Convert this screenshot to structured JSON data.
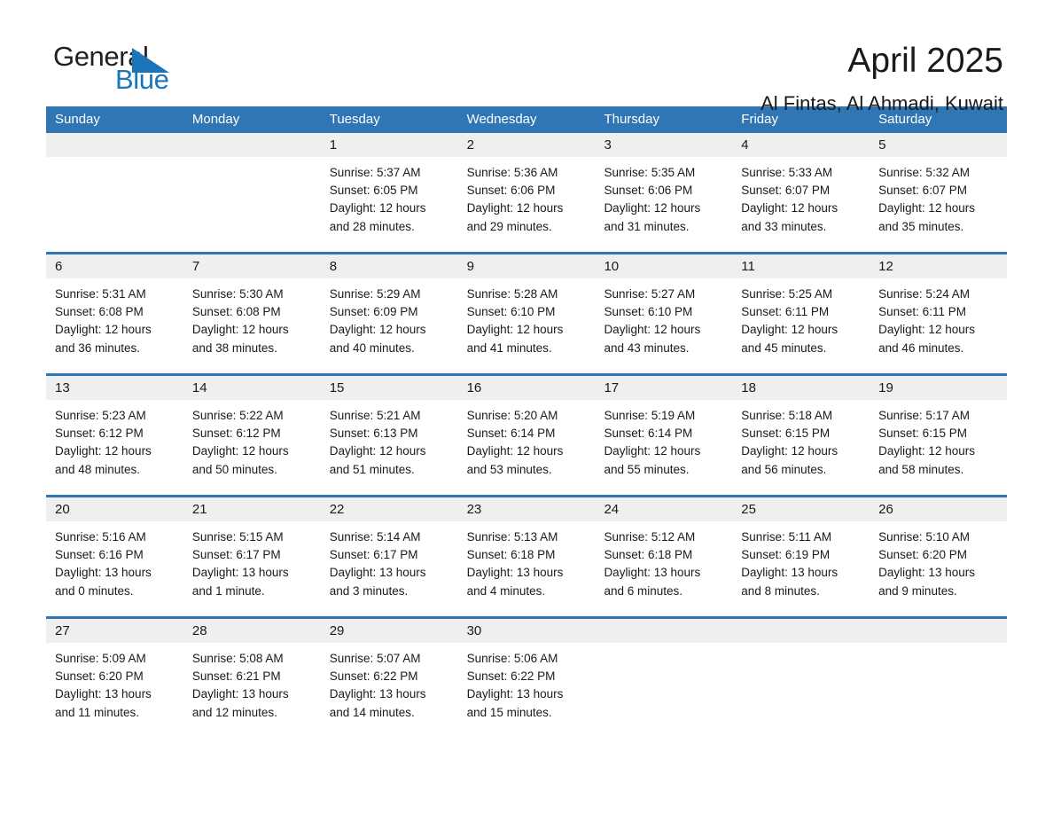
{
  "brand": {
    "name_part1": "General",
    "name_part2": "Blue",
    "triangle_icon": "triangle-icon",
    "accent_color": "#1b75bb"
  },
  "header": {
    "month_title": "April 2025",
    "location": "Al Fintas, Al Ahmadi, Kuwait"
  },
  "colors": {
    "header_blue": "#3076b5",
    "date_band_gray": "#efefef",
    "page_background": "#ffffff"
  },
  "weekday_headers": [
    "Sunday",
    "Monday",
    "Tuesday",
    "Wednesday",
    "Thursday",
    "Friday",
    "Saturday"
  ],
  "weeks": [
    {
      "days": [
        {
          "num": "",
          "empty": true,
          "sunrise": "",
          "sunset": "",
          "daylight_line1": "",
          "daylight_line2": ""
        },
        {
          "num": "",
          "empty": true,
          "sunrise": "",
          "sunset": "",
          "daylight_line1": "",
          "daylight_line2": ""
        },
        {
          "num": "1",
          "empty": false,
          "sunrise": "Sunrise: 5:37 AM",
          "sunset": "Sunset: 6:05 PM",
          "daylight_line1": "Daylight: 12 hours",
          "daylight_line2": "and 28 minutes."
        },
        {
          "num": "2",
          "empty": false,
          "sunrise": "Sunrise: 5:36 AM",
          "sunset": "Sunset: 6:06 PM",
          "daylight_line1": "Daylight: 12 hours",
          "daylight_line2": "and 29 minutes."
        },
        {
          "num": "3",
          "empty": false,
          "sunrise": "Sunrise: 5:35 AM",
          "sunset": "Sunset: 6:06 PM",
          "daylight_line1": "Daylight: 12 hours",
          "daylight_line2": "and 31 minutes."
        },
        {
          "num": "4",
          "empty": false,
          "sunrise": "Sunrise: 5:33 AM",
          "sunset": "Sunset: 6:07 PM",
          "daylight_line1": "Daylight: 12 hours",
          "daylight_line2": "and 33 minutes."
        },
        {
          "num": "5",
          "empty": false,
          "sunrise": "Sunrise: 5:32 AM",
          "sunset": "Sunset: 6:07 PM",
          "daylight_line1": "Daylight: 12 hours",
          "daylight_line2": "and 35 minutes."
        }
      ]
    },
    {
      "days": [
        {
          "num": "6",
          "empty": false,
          "sunrise": "Sunrise: 5:31 AM",
          "sunset": "Sunset: 6:08 PM",
          "daylight_line1": "Daylight: 12 hours",
          "daylight_line2": "and 36 minutes."
        },
        {
          "num": "7",
          "empty": false,
          "sunrise": "Sunrise: 5:30 AM",
          "sunset": "Sunset: 6:08 PM",
          "daylight_line1": "Daylight: 12 hours",
          "daylight_line2": "and 38 minutes."
        },
        {
          "num": "8",
          "empty": false,
          "sunrise": "Sunrise: 5:29 AM",
          "sunset": "Sunset: 6:09 PM",
          "daylight_line1": "Daylight: 12 hours",
          "daylight_line2": "and 40 minutes."
        },
        {
          "num": "9",
          "empty": false,
          "sunrise": "Sunrise: 5:28 AM",
          "sunset": "Sunset: 6:10 PM",
          "daylight_line1": "Daylight: 12 hours",
          "daylight_line2": "and 41 minutes."
        },
        {
          "num": "10",
          "empty": false,
          "sunrise": "Sunrise: 5:27 AM",
          "sunset": "Sunset: 6:10 PM",
          "daylight_line1": "Daylight: 12 hours",
          "daylight_line2": "and 43 minutes."
        },
        {
          "num": "11",
          "empty": false,
          "sunrise": "Sunrise: 5:25 AM",
          "sunset": "Sunset: 6:11 PM",
          "daylight_line1": "Daylight: 12 hours",
          "daylight_line2": "and 45 minutes."
        },
        {
          "num": "12",
          "empty": false,
          "sunrise": "Sunrise: 5:24 AM",
          "sunset": "Sunset: 6:11 PM",
          "daylight_line1": "Daylight: 12 hours",
          "daylight_line2": "and 46 minutes."
        }
      ]
    },
    {
      "days": [
        {
          "num": "13",
          "empty": false,
          "sunrise": "Sunrise: 5:23 AM",
          "sunset": "Sunset: 6:12 PM",
          "daylight_line1": "Daylight: 12 hours",
          "daylight_line2": "and 48 minutes."
        },
        {
          "num": "14",
          "empty": false,
          "sunrise": "Sunrise: 5:22 AM",
          "sunset": "Sunset: 6:12 PM",
          "daylight_line1": "Daylight: 12 hours",
          "daylight_line2": "and 50 minutes."
        },
        {
          "num": "15",
          "empty": false,
          "sunrise": "Sunrise: 5:21 AM",
          "sunset": "Sunset: 6:13 PM",
          "daylight_line1": "Daylight: 12 hours",
          "daylight_line2": "and 51 minutes."
        },
        {
          "num": "16",
          "empty": false,
          "sunrise": "Sunrise: 5:20 AM",
          "sunset": "Sunset: 6:14 PM",
          "daylight_line1": "Daylight: 12 hours",
          "daylight_line2": "and 53 minutes."
        },
        {
          "num": "17",
          "empty": false,
          "sunrise": "Sunrise: 5:19 AM",
          "sunset": "Sunset: 6:14 PM",
          "daylight_line1": "Daylight: 12 hours",
          "daylight_line2": "and 55 minutes."
        },
        {
          "num": "18",
          "empty": false,
          "sunrise": "Sunrise: 5:18 AM",
          "sunset": "Sunset: 6:15 PM",
          "daylight_line1": "Daylight: 12 hours",
          "daylight_line2": "and 56 minutes."
        },
        {
          "num": "19",
          "empty": false,
          "sunrise": "Sunrise: 5:17 AM",
          "sunset": "Sunset: 6:15 PM",
          "daylight_line1": "Daylight: 12 hours",
          "daylight_line2": "and 58 minutes."
        }
      ]
    },
    {
      "days": [
        {
          "num": "20",
          "empty": false,
          "sunrise": "Sunrise: 5:16 AM",
          "sunset": "Sunset: 6:16 PM",
          "daylight_line1": "Daylight: 13 hours",
          "daylight_line2": "and 0 minutes."
        },
        {
          "num": "21",
          "empty": false,
          "sunrise": "Sunrise: 5:15 AM",
          "sunset": "Sunset: 6:17 PM",
          "daylight_line1": "Daylight: 13 hours",
          "daylight_line2": "and 1 minute."
        },
        {
          "num": "22",
          "empty": false,
          "sunrise": "Sunrise: 5:14 AM",
          "sunset": "Sunset: 6:17 PM",
          "daylight_line1": "Daylight: 13 hours",
          "daylight_line2": "and 3 minutes."
        },
        {
          "num": "23",
          "empty": false,
          "sunrise": "Sunrise: 5:13 AM",
          "sunset": "Sunset: 6:18 PM",
          "daylight_line1": "Daylight: 13 hours",
          "daylight_line2": "and 4 minutes."
        },
        {
          "num": "24",
          "empty": false,
          "sunrise": "Sunrise: 5:12 AM",
          "sunset": "Sunset: 6:18 PM",
          "daylight_line1": "Daylight: 13 hours",
          "daylight_line2": "and 6 minutes."
        },
        {
          "num": "25",
          "empty": false,
          "sunrise": "Sunrise: 5:11 AM",
          "sunset": "Sunset: 6:19 PM",
          "daylight_line1": "Daylight: 13 hours",
          "daylight_line2": "and 8 minutes."
        },
        {
          "num": "26",
          "empty": false,
          "sunrise": "Sunrise: 5:10 AM",
          "sunset": "Sunset: 6:20 PM",
          "daylight_line1": "Daylight: 13 hours",
          "daylight_line2": "and 9 minutes."
        }
      ]
    },
    {
      "days": [
        {
          "num": "27",
          "empty": false,
          "sunrise": "Sunrise: 5:09 AM",
          "sunset": "Sunset: 6:20 PM",
          "daylight_line1": "Daylight: 13 hours",
          "daylight_line2": "and 11 minutes."
        },
        {
          "num": "28",
          "empty": false,
          "sunrise": "Sunrise: 5:08 AM",
          "sunset": "Sunset: 6:21 PM",
          "daylight_line1": "Daylight: 13 hours",
          "daylight_line2": "and 12 minutes."
        },
        {
          "num": "29",
          "empty": false,
          "sunrise": "Sunrise: 5:07 AM",
          "sunset": "Sunset: 6:22 PM",
          "daylight_line1": "Daylight: 13 hours",
          "daylight_line2": "and 14 minutes."
        },
        {
          "num": "30",
          "empty": false,
          "sunrise": "Sunrise: 5:06 AM",
          "sunset": "Sunset: 6:22 PM",
          "daylight_line1": "Daylight: 13 hours",
          "daylight_line2": "and 15 minutes."
        },
        {
          "num": "",
          "empty": true,
          "sunrise": "",
          "sunset": "",
          "daylight_line1": "",
          "daylight_line2": ""
        },
        {
          "num": "",
          "empty": true,
          "sunrise": "",
          "sunset": "",
          "daylight_line1": "",
          "daylight_line2": ""
        },
        {
          "num": "",
          "empty": true,
          "sunrise": "",
          "sunset": "",
          "daylight_line1": "",
          "daylight_line2": ""
        }
      ]
    }
  ]
}
